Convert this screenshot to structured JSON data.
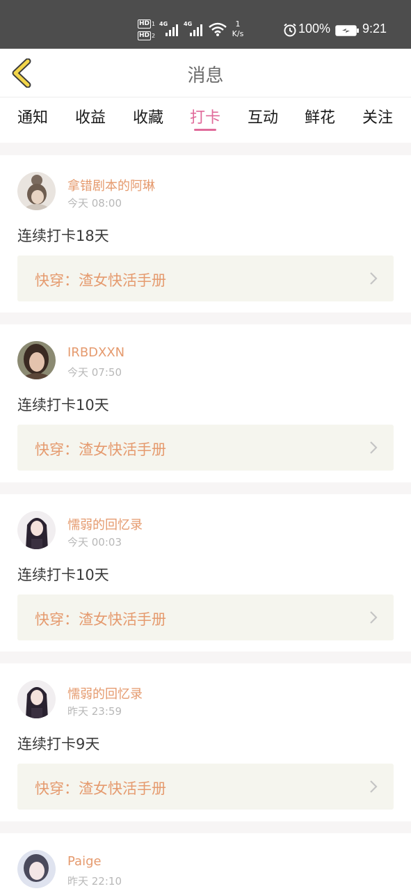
{
  "status_bar": {
    "hd1": "HD",
    "hd1_num": "1",
    "hd2": "HD",
    "hd2_num": "2",
    "net1": "4G",
    "net2": "4G",
    "speed_value": "1",
    "speed_unit": "K/s",
    "battery": "100%",
    "time": "9:21",
    "icons": [
      "signal-icon",
      "wifi-icon",
      "alarm-icon",
      "battery-charging-icon"
    ]
  },
  "header": {
    "title": "消息",
    "back_icon": "chevron-left-icon",
    "back_color": "#f2d54a"
  },
  "tabs": [
    {
      "label": "通知",
      "active": false
    },
    {
      "label": "收益",
      "active": false
    },
    {
      "label": "收藏",
      "active": false
    },
    {
      "label": "打卡",
      "active": true
    },
    {
      "label": "互动",
      "active": false
    },
    {
      "label": "鲜花",
      "active": false
    },
    {
      "label": "关注",
      "active": false
    }
  ],
  "colors": {
    "accent": "#e06a9a",
    "username": "#e59a6e",
    "book_bg": "#f5f5ee"
  },
  "messages": [
    {
      "username": "拿错剧本的阿琳",
      "time": "今天 08:00",
      "text": "连续打卡18天",
      "book": "快穿：渣女快活手册"
    },
    {
      "username": "IRBDXXN",
      "time": "今天 07:50",
      "text": "连续打卡10天",
      "book": "快穿：渣女快活手册"
    },
    {
      "username": "懦弱的回忆录",
      "time": "今天 00:03",
      "text": "连续打卡10天",
      "book": "快穿：渣女快活手册"
    },
    {
      "username": "懦弱的回忆录",
      "time": "昨天 23:59",
      "text": "连续打卡9天",
      "book": "快穿：渣女快活手册"
    },
    {
      "username": "Paige",
      "time": "昨天 22:10"
    }
  ]
}
